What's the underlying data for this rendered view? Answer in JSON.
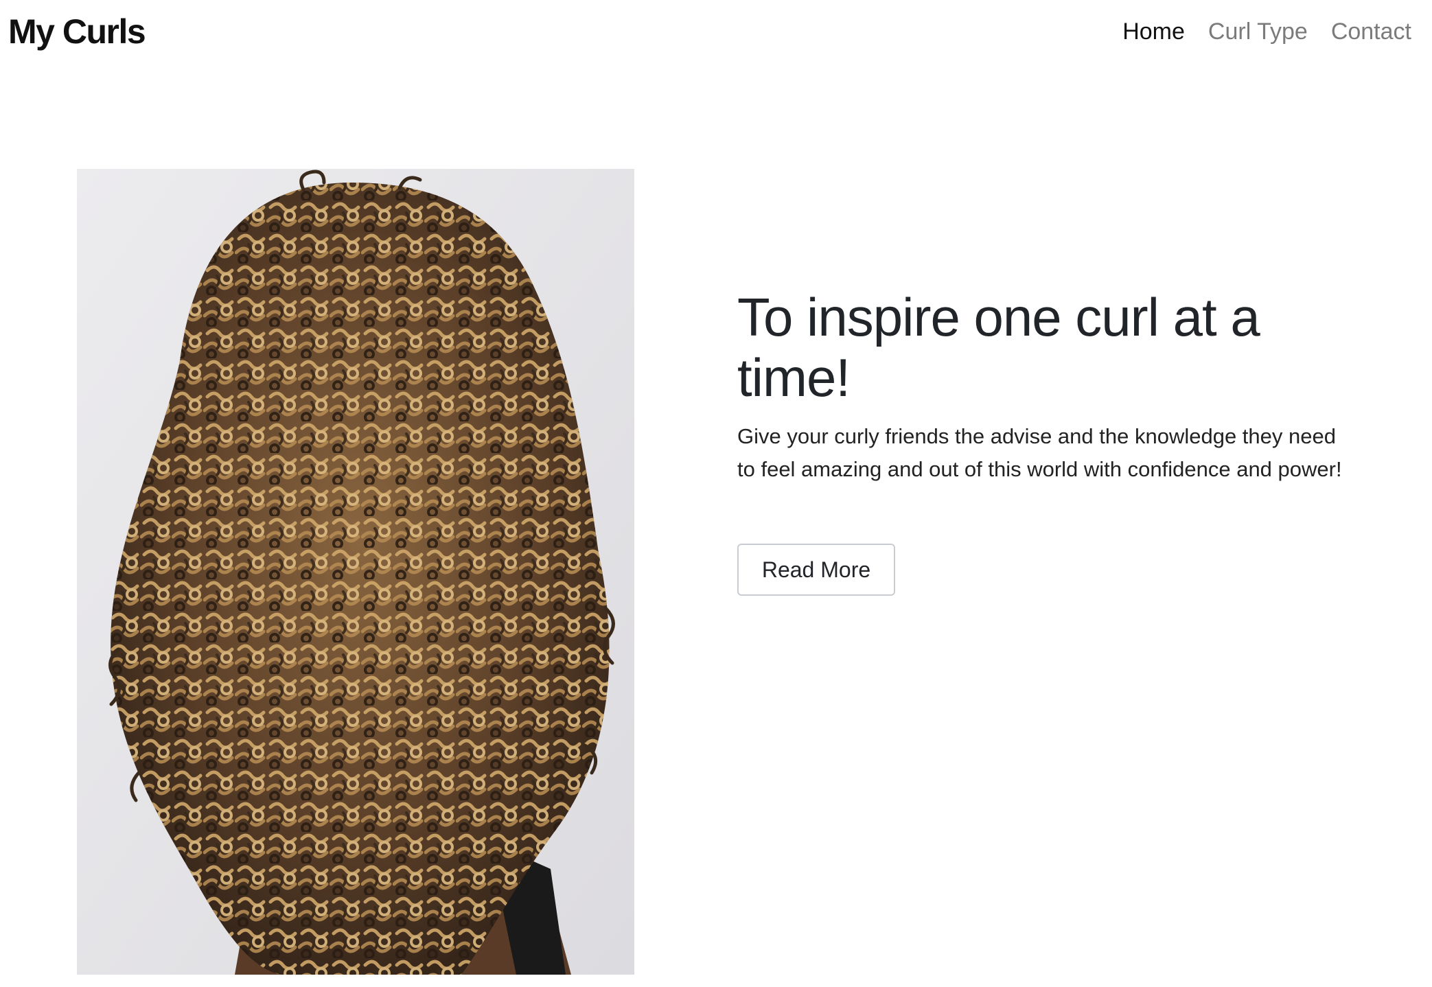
{
  "navbar": {
    "brand": "My Curls",
    "links": [
      {
        "label": "Home",
        "active": true
      },
      {
        "label": "Curl Type",
        "active": false
      },
      {
        "label": "Contact",
        "active": false
      }
    ]
  },
  "hero": {
    "image": {
      "subject": "curly-hair-back-view",
      "background_color": "#e8e7ea",
      "hair_dark": "#3a2a1c",
      "hair_mid": "#7a5a36",
      "hair_light": "#c9a266",
      "skin": "#5a3b28",
      "shirt": "#1a1a1a"
    },
    "heading": "To inspire one curl at a time!",
    "lead": "Give your curly friends the advise and the knowledge they need to feel amazing and out of this world with confidence and power!",
    "cta_label": "Read More"
  }
}
